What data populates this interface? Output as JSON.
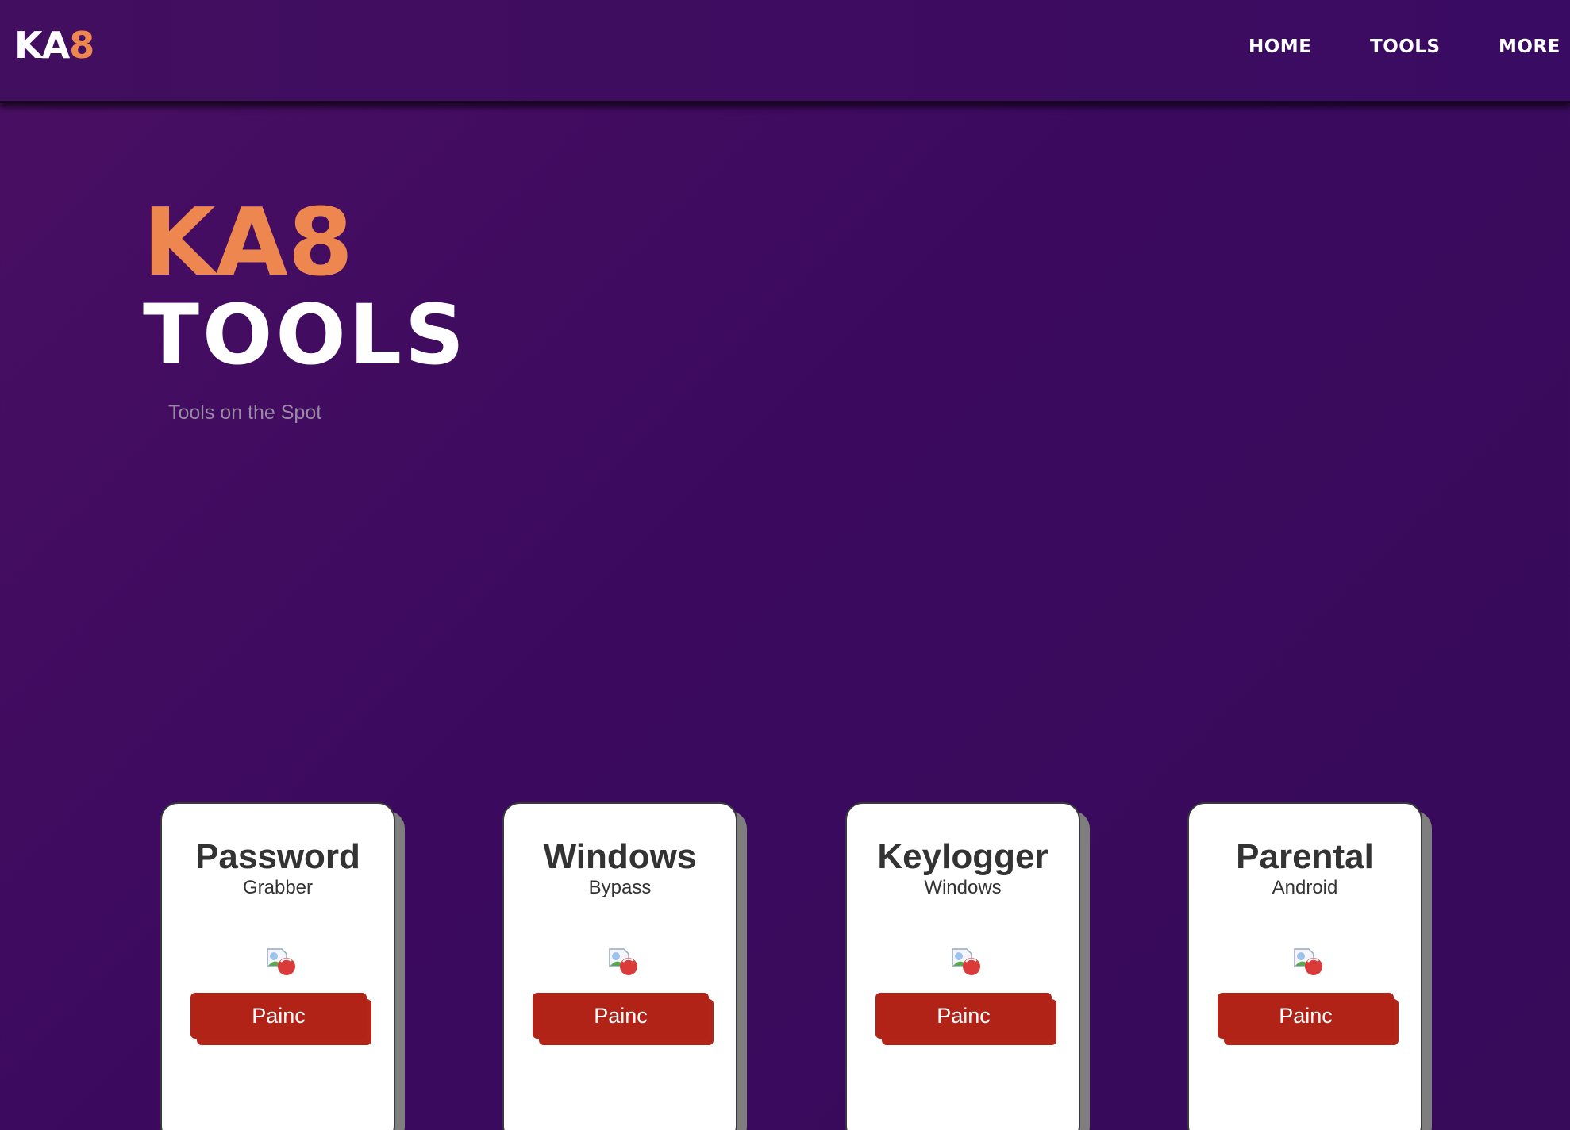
{
  "brand": {
    "logo_main": "KA",
    "logo_accent": "8",
    "accent_color": "#ee8650",
    "background_color": "#3b0a5f"
  },
  "nav": {
    "items": [
      {
        "label": "HOME"
      },
      {
        "label": "TOOLS"
      },
      {
        "label": "MORE"
      }
    ]
  },
  "hero": {
    "title_line1": "KA8",
    "title_line2": "TOOLS",
    "subtitle": "Tools on the Spot"
  },
  "cards": [
    {
      "title": "Password",
      "subtitle": "Grabber",
      "image": "broken-image-icon",
      "button_label": "Painc"
    },
    {
      "title": "Windows",
      "subtitle": "Bypass",
      "image": "broken-image-icon",
      "button_label": "Painc"
    },
    {
      "title": "Keylogger",
      "subtitle": "Windows",
      "image": "broken-image-icon",
      "button_label": "Painc"
    },
    {
      "title": "Parental",
      "subtitle": "Android",
      "image": "broken-image-icon",
      "button_label": "Painc"
    }
  ],
  "button_color": "#b22317"
}
